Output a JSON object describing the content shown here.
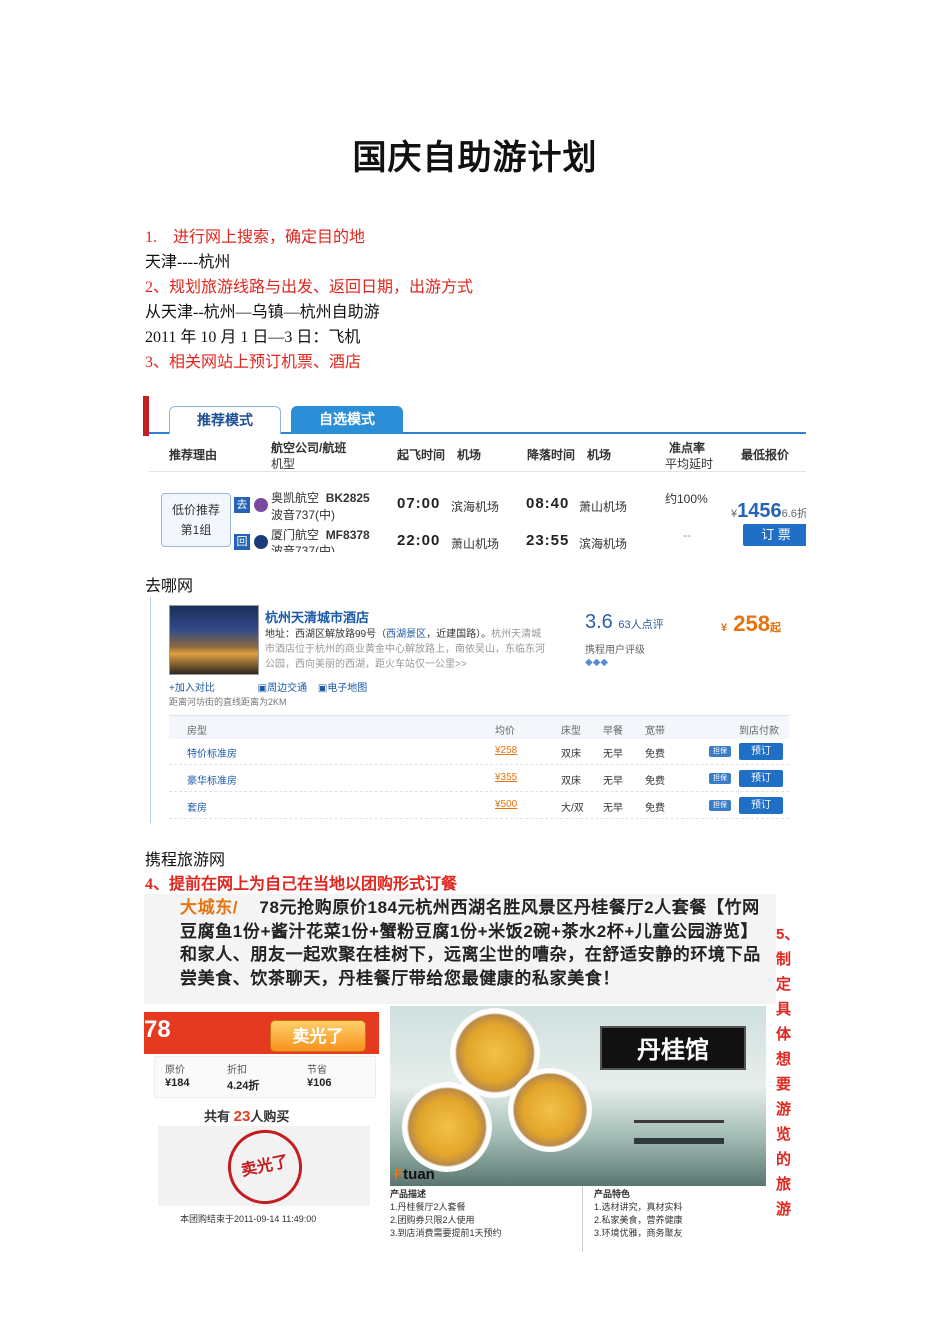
{
  "doc": {
    "title": "国庆自助游计划",
    "step1_num": "1.",
    "step1": "进行网上搜索，确定目的地",
    "route_short": "天津----杭州",
    "step2": "2、规划旅游线路与出发、返回日期，出游方式",
    "route_long": "从天津--杭州—乌镇—杭州自助游",
    "dates": "2011 年 10 月 1 日—3 日：飞机",
    "step3": "3、相关网站上预订机票、酒店",
    "caption_qunar": "去哪网",
    "caption_ctrip": "携程旅游网",
    "step4": "4、提前在网上为自己在当地以团购形式订餐",
    "step5_chars": [
      "5、",
      "制",
      "定",
      "具",
      "体",
      "想",
      "要",
      "游",
      "览",
      "的",
      "旅",
      "游"
    ]
  },
  "flight": {
    "tab_recommend": "推荐模式",
    "tab_custom": "自选模式",
    "headers": {
      "reason": "推荐理由",
      "airline": "航空公司/航班",
      "model": "机型",
      "dep": "起飞时间　机场",
      "arr": "降落时间　机场",
      "ontime": "准点率",
      "delay": "平均延时",
      "lowest": "最低报价"
    },
    "reco_line1": "低价推荐",
    "reco_line2": "第1组",
    "rows": [
      {
        "tag": "去",
        "airline": "奥凯航空",
        "flight_no": "BK2825",
        "plane": "波音737(中)",
        "dep_time": "07:00",
        "dep_airport": "滨海机场",
        "arr_time": "08:40",
        "arr_airport": "萧山机场",
        "ontime": "约100%"
      },
      {
        "tag": "回",
        "airline": "厦门航空",
        "flight_no": "MF8378",
        "plane": "波音737(中)",
        "dep_time": "22:00",
        "dep_airport": "萧山机场",
        "arr_time": "23:55",
        "arr_airport": "滨海机场",
        "ontime": "--"
      }
    ],
    "currency": "¥",
    "price": "1456",
    "discount": "6.6折",
    "book": "订 票"
  },
  "hotel": {
    "name": "杭州天清城市酒店",
    "addr_prefix": "地址：西湖区解放路99号（",
    "addr_link": "西湖景区",
    "addr_mid": "，近建国路）。",
    "addr_desc": "杭州天清城市酒店位于杭州的商业黄金中心解放路上，南依吴山，东临东河公园，西向美丽的西湖，距火车站仅一公里>>",
    "score": "3.6",
    "reviews": "63人点评",
    "rating_label": "携程用户评级",
    "currency": "¥",
    "price": "258",
    "price_suffix": "起",
    "link_compare": "+加入对比",
    "link_transport": "周边交通",
    "link_map": "电子地图",
    "distance": "距离河坊街的直线距离为2KM",
    "cols": {
      "room": "房型",
      "avg": "均价",
      "bed": "床型",
      "breakfast": "早餐",
      "broadband": "宽带",
      "pay": "到店付款"
    },
    "rooms": [
      {
        "name": "特价标准房",
        "price": "¥258",
        "bed": "双床",
        "breakfast": "无早",
        "net": "免费",
        "tag": "担保",
        "btn": "预订"
      },
      {
        "name": "豪华标准房",
        "price": "¥355",
        "bed": "双床",
        "breakfast": "无早",
        "net": "免费",
        "tag": "担保",
        "btn": "预订"
      },
      {
        "name": "套房",
        "price": "¥500",
        "bed": "大/双",
        "breakfast": "无早",
        "net": "免费",
        "tag": "担保",
        "btn": "预订"
      }
    ]
  },
  "group": {
    "prefix": "大城东/",
    "desc": "78元抢购原价184元杭州西湖名胜风景区丹桂餐厅2人套餐【竹网豆腐鱼1份+酱汁花菜1份+蟹粉豆腐1份+米饭2碗+茶水2杯+儿童公园游览】和家人、朋友一起欢聚在桂树下，远离尘世的嘈杂，在舒适安静的环境下品尝美食、饮茶聊天，丹桂餐厅带给您最健康的私家美食！",
    "price_cut": "78",
    "sold_out": "卖光了",
    "orig_label": "原价",
    "orig": "¥184",
    "disc_label": "折扣",
    "disc": "4.24折",
    "save_label": "节省",
    "save": "¥106",
    "buyers_pre": "共有",
    "buyers_num": "23",
    "buyers_post": "人购买",
    "stamp": "卖光了",
    "end_time": "本团购结束于2011-09-14 11:49:00",
    "shop_sign": "丹桂馆",
    "brand_f": "F",
    "brand_rest": "tuan",
    "desc_title": "产品描述",
    "desc_items": [
      "1.丹桂餐厅2人套餐",
      "2.团购券只限2人使用",
      "3.到店消费需要提前1天预约"
    ],
    "feat_title": "产品特色",
    "feat_items": [
      "1.选材讲究，真材实料",
      "2.私家美食，营养健康",
      "3.环境优雅，商务聚友"
    ]
  }
}
